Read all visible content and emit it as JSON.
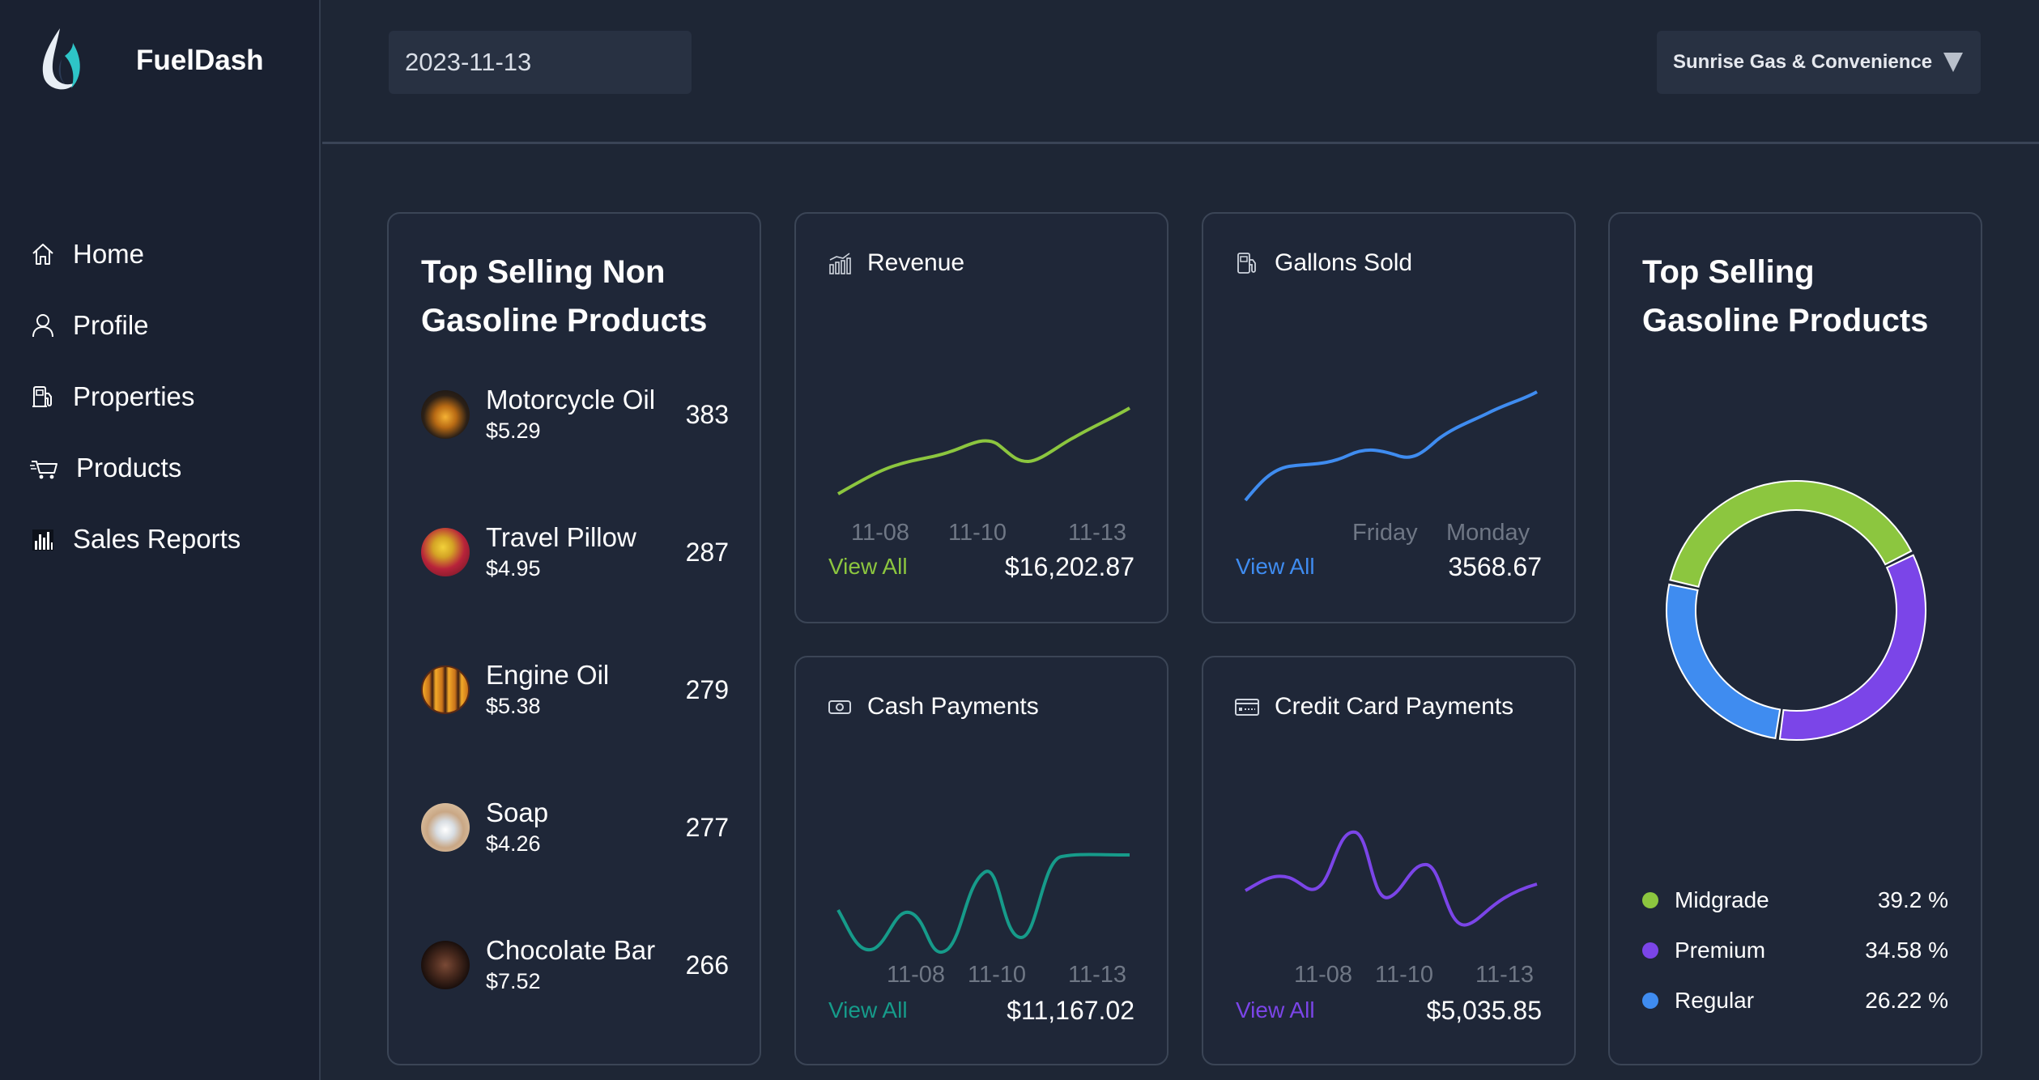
{
  "app": {
    "name": "FuelDash"
  },
  "sidebar": {
    "items": [
      {
        "label": "Home",
        "icon": "home-icon"
      },
      {
        "label": "Profile",
        "icon": "user-icon"
      },
      {
        "label": "Properties",
        "icon": "fuel-pump-icon"
      },
      {
        "label": "Products",
        "icon": "cart-icon"
      },
      {
        "label": "Sales Reports",
        "icon": "bar-chart-icon"
      }
    ]
  },
  "header": {
    "date_value": "2023-11-13",
    "station_select": "Sunrise Gas & Convenience"
  },
  "non_gas": {
    "title_line1": "Top Selling Non",
    "title_line2": "Gasoline Products",
    "items": [
      {
        "name": "Motorcycle Oil",
        "price": "$5.29",
        "count": "383"
      },
      {
        "name": "Travel Pillow",
        "price": "$4.95",
        "count": "287"
      },
      {
        "name": "Engine Oil",
        "price": "$5.38",
        "count": "279"
      },
      {
        "name": "Soap",
        "price": "$4.26",
        "count": "277"
      },
      {
        "name": "Chocolate Bar",
        "price": "$7.52",
        "count": "266"
      }
    ]
  },
  "metrics": {
    "revenue": {
      "title": "Revenue",
      "view_all": "View All",
      "value": "$16,202.87",
      "ticks": [
        "11-08",
        "11-10",
        "11-13"
      ],
      "color": "#8cc63f"
    },
    "gallons": {
      "title": "Gallons Sold",
      "view_all": "View All",
      "value": "3568.67",
      "ticks": [
        "Friday",
        "Monday"
      ],
      "color": "#3f8cf0"
    },
    "cash": {
      "title": "Cash Payments",
      "view_all": "View All",
      "value": "$11,167.02",
      "ticks": [
        "11-08",
        "11-10",
        "11-13"
      ],
      "color": "#169b8a"
    },
    "credit": {
      "title": "Credit Card Payments",
      "view_all": "View All",
      "value": "$5,035.85",
      "ticks": [
        "11-08",
        "11-10",
        "11-13"
      ],
      "color": "#7b45e8"
    }
  },
  "gas": {
    "title_line1": "Top Selling",
    "title_line2": "Gasoline Products",
    "legend": [
      {
        "name": "Midgrade",
        "pct": "39.2 %",
        "color": "#8cc63f"
      },
      {
        "name": "Premium",
        "pct": "34.58 %",
        "color": "#7b45e8"
      },
      {
        "name": "Regular",
        "pct": "26.22 %",
        "color": "#3f8cf0"
      }
    ]
  },
  "chart_data": [
    {
      "type": "pie",
      "title": "Top Selling Gasoline Products",
      "categories": [
        "Midgrade",
        "Premium",
        "Regular"
      ],
      "values": [
        39.2,
        34.58,
        26.22
      ]
    }
  ]
}
